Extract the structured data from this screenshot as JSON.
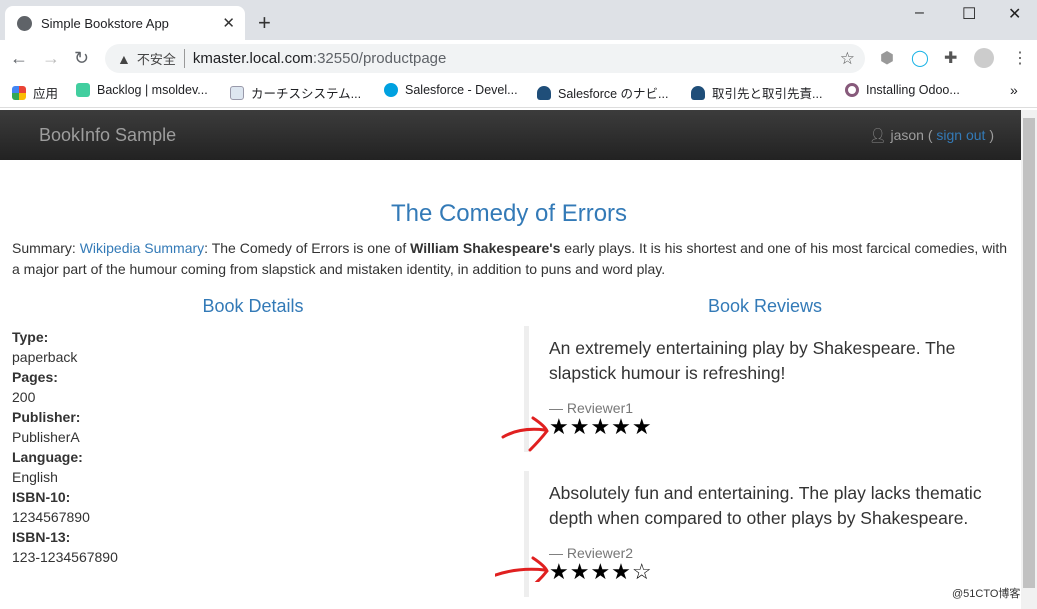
{
  "browser": {
    "tab_title": "Simple Bookstore App",
    "security_label": "不安全",
    "url_host": "kmaster.local.com",
    "url_path": ":32550/productpage",
    "bookmarks": [
      "应用",
      "Backlog | msoldev...",
      "カーチスシステム...",
      "Salesforce - Devel...",
      "Salesforce のナビ...",
      "取引先と取引先責...",
      "Installing Odoo..."
    ]
  },
  "navbar": {
    "brand": "BookInfo Sample",
    "user": "jason",
    "open_paren": " ( ",
    "sign_out": "sign out",
    "close_paren": " )"
  },
  "product": {
    "title": "The Comedy of Errors",
    "summary_label": "Summary: ",
    "summary_link": "Wikipedia Summary",
    "summary_pre": ": The Comedy of Errors is one of ",
    "summary_bold": "William Shakespeare's",
    "summary_post": " early plays. It is his shortest and one of his most farcical comedies, with a major part of the humour coming from slapstick and mistaken identity, in addition to puns and word play."
  },
  "details": {
    "heading": "Book Details",
    "fields": [
      {
        "label": "Type:",
        "value": "paperback"
      },
      {
        "label": "Pages:",
        "value": "200"
      },
      {
        "label": "Publisher:",
        "value": "PublisherA"
      },
      {
        "label": "Language:",
        "value": "English"
      },
      {
        "label": "ISBN-10:",
        "value": "1234567890"
      },
      {
        "label": "ISBN-13:",
        "value": "123-1234567890"
      }
    ]
  },
  "reviews": {
    "heading": "Book Reviews",
    "items": [
      {
        "text": "An extremely entertaining play by Shakespeare. The slapstick humour is refreshing!",
        "reviewer": "— Reviewer1",
        "rating": 5,
        "stars": "★★★★★"
      },
      {
        "text": "Absolutely fun and entertaining. The play lacks thematic depth when compared to other plays by Shakespeare.",
        "reviewer": "— Reviewer2",
        "rating": 4,
        "stars": "★★★★☆"
      }
    ]
  },
  "annotation_color": "#e02020",
  "watermark": "@51CTO博客"
}
